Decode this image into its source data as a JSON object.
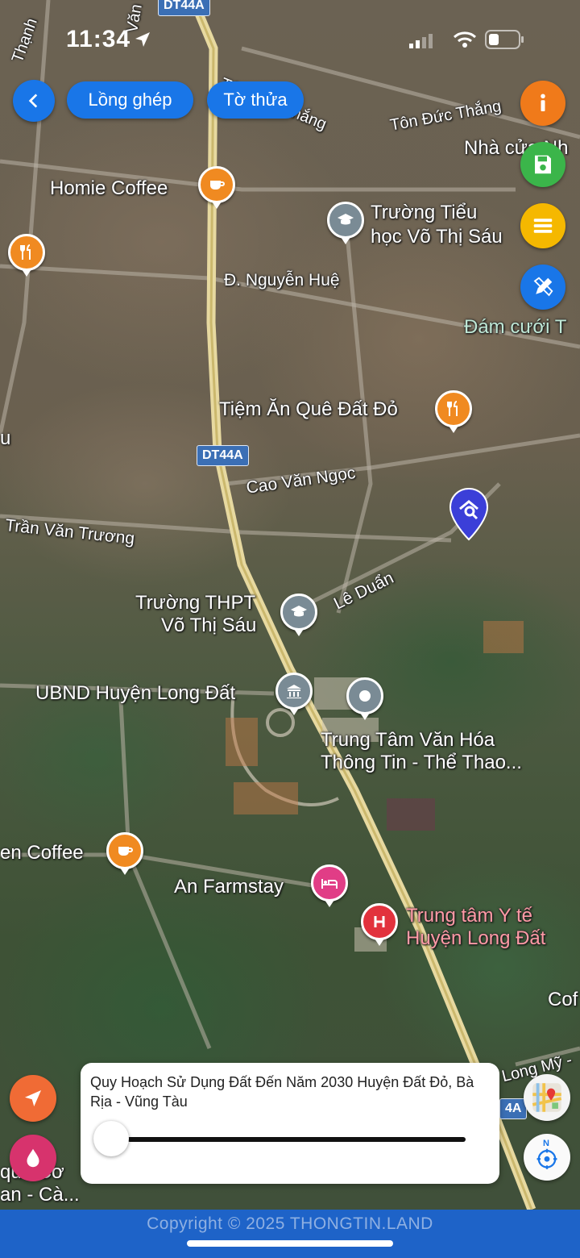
{
  "status_bar": {
    "time": "11:34"
  },
  "nav": {
    "back_icon": "chevron-left-icon",
    "long_ghep": "Lồng ghép",
    "to_thua": "Tờ thửa"
  },
  "map": {
    "roads": {
      "dt44a_top": "DT44A",
      "dt44a_mid": "DT44A",
      "dt44a_bottom": "4A",
      "ton_duc_thang_1": "Tôn Đức Thắng",
      "ton_duc_thang_2": "Tôn Đức Thắng",
      "nguyen_hue": "Đ. Nguyễn Huệ",
      "cao_van_ngoc": "Cao Văn Ngọc",
      "tran_van_truong": "Trần Văn Trương",
      "le_duan": "Lê Duẩn",
      "long_my": "Long Mỹ -",
      "van_viec": "Văn Việc",
      "thanh": "Thạnh"
    },
    "places": {
      "homie_coffee": "Homie Coffee",
      "truong_tieu_hoc_1": "Trường Tiểu",
      "truong_tieu_hoc_2": "học Võ Thị Sáu",
      "nha_cua": "Nhà cửa Nh",
      "dam_cuoi": "Đám cưới T",
      "tiem_an": "Tiệm Ăn Quê Đất Đỏ",
      "truong_thpt_1": "Trường THPT",
      "truong_thpt_2": "Võ Thị Sáu",
      "ubnd": "UBND Huyện Long Đất",
      "trung_tam_vh_1": "Trung Tâm Văn Hóa",
      "trung_tam_vh_2": "Thông Tin - Thể Thao...",
      "en_coffee": "en Coffee",
      "an_farmstay": "An Farmstay",
      "trung_tam_yte_1": "Trung tâm Y tế",
      "trung_tam_yte_2": "Huyện Long Đất",
      "cof": "Cof",
      "u_left": "u",
      "que_co_1": "quê Cơ",
      "que_co_2": "an - Cà..."
    }
  },
  "side_buttons": {
    "info": {
      "icon": "info-icon",
      "color": "#f07a1a"
    },
    "save": {
      "icon": "save-icon",
      "color": "#3bb54a"
    },
    "list": {
      "icon": "list-icon",
      "color": "#f5b800"
    },
    "edit": {
      "icon": "pencil-ruler-icon",
      "color": "#1976e8"
    }
  },
  "bottom_left": {
    "locate": {
      "icon": "navigation-arrow-icon",
      "color": "#f06b35"
    },
    "drop": {
      "icon": "water-drop-icon",
      "color": "#d7336d"
    }
  },
  "bottom_right": {
    "map_type_icon": "map-thumbnail-icon",
    "compass_label": "N"
  },
  "panel": {
    "title": "Quy Hoạch Sử Dụng Đất Đến Năm 2030 Huyện Đất Đỏ, Bà Rịa - Vũng Tàu",
    "opacity_value": 0
  },
  "footer": {
    "copyright": "Copyright © 2025 THONGTIN.LAND"
  }
}
